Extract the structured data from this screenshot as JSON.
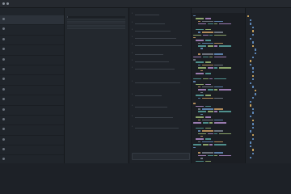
{
  "top_bar": {
    "tabs": [
      "",
      "",
      "",
      ""
    ]
  },
  "left_panel": {
    "header": "",
    "items": [
      {
        "text": "",
        "sub": ""
      },
      {
        "text": "",
        "sub": ""
      },
      {
        "text": "",
        "sub": ""
      },
      {
        "text": "",
        "sub": ""
      },
      {
        "text": "",
        "sub": ""
      },
      {
        "text": "",
        "sub": ""
      },
      {
        "text": "",
        "sub": ""
      },
      {
        "text": "",
        "sub": ""
      },
      {
        "text": "",
        "sub": ""
      },
      {
        "text": "",
        "sub": ""
      },
      {
        "text": "",
        "sub": ""
      },
      {
        "text": "",
        "sub": ""
      },
      {
        "text": "",
        "sub": ""
      },
      {
        "text": "",
        "sub": ""
      },
      {
        "text": "",
        "sub": ""
      },
      {
        "text": "",
        "sub": ""
      }
    ]
  },
  "document": {
    "title": "",
    "headings": [
      "",
      "",
      "",
      ""
    ],
    "paragraphs": [
      "",
      "",
      "",
      "",
      "",
      "",
      ""
    ],
    "code_lines": [
      "",
      "",
      "",
      "",
      ""
    ],
    "table": {
      "header": [
        "",
        "",
        ""
      ],
      "rows": [
        [
          "",
          "",
          ""
        ],
        [
          "",
          "",
          ""
        ],
        [
          "",
          "",
          ""
        ],
        [
          "",
          "",
          ""
        ],
        [
          "",
          "",
          ""
        ],
        [
          "",
          "",
          ""
        ],
        [
          "",
          "",
          ""
        ]
      ]
    }
  },
  "chat": {
    "items": [
      "",
      "",
      "",
      "",
      "",
      "",
      "",
      "",
      "",
      "",
      "",
      "",
      ""
    ]
  },
  "editor": {
    "tabs": [
      "",
      ""
    ]
  },
  "file_tree": {
    "header": "",
    "rows": [
      "",
      "",
      "",
      "",
      "",
      "",
      "",
      "",
      "",
      "",
      "",
      "",
      "",
      "",
      "",
      "",
      "",
      "",
      "",
      "",
      "",
      "",
      "",
      "",
      "",
      "",
      "",
      "",
      "",
      "",
      "",
      "",
      "",
      "",
      "",
      "",
      "",
      "",
      ""
    ]
  },
  "colors": {
    "background": "#1e2228",
    "panel": "#20252b",
    "editor_background": "#1b1e23",
    "text": "#aeb4bd",
    "folder_icon": "#c9a25a",
    "file_icon": "#5d87b8"
  }
}
